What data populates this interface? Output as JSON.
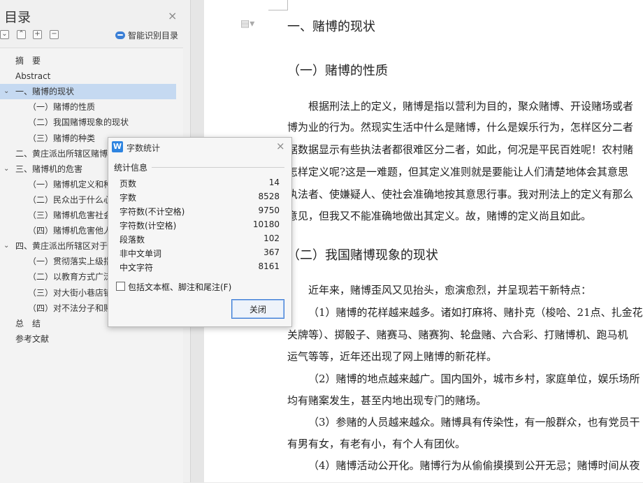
{
  "nav": {
    "title": "目录",
    "close_glyph": "×",
    "smart_label": "智能识别目录",
    "toc": [
      {
        "label": "摘　要"
      },
      {
        "label": "Abstract"
      },
      {
        "label": "一、赌博的现状",
        "expanded": true,
        "selected": true
      },
      {
        "label": "（一）赌博的性质"
      },
      {
        "label": "（二）我国赌博现象的现状"
      },
      {
        "label": "（三）赌博的种类"
      },
      {
        "label": "二、黄庄派出所辖区赌博"
      },
      {
        "label": "三、赌博机的危害",
        "expanded": true
      },
      {
        "label": "（一）赌博机定义和种"
      },
      {
        "label": "（二）民众出于什么心"
      },
      {
        "label": "（三）赌博机危害社会"
      },
      {
        "label": "（四）赌博机危害他人"
      },
      {
        "label": "四、黄庄派出所辖区对于",
        "expanded": true
      },
      {
        "label": "（一）贯彻落实上级指"
      },
      {
        "label": "（二）以教育方式广泛"
      },
      {
        "label": "（三）对大街小巷店铺"
      },
      {
        "label": "（四）对不法分子和赌"
      },
      {
        "label": "总　结"
      },
      {
        "label": "参考文献"
      }
    ]
  },
  "dialog": {
    "title": "字数统计",
    "icon_letter": "W",
    "section": "统计信息",
    "stats": [
      {
        "label": "页数",
        "value": "14"
      },
      {
        "label": "字数",
        "value": "8528"
      },
      {
        "label": "字符数(不计空格)",
        "value": "9750"
      },
      {
        "label": "字符数(计空格)",
        "value": "10180"
      },
      {
        "label": "段落数",
        "value": "102"
      },
      {
        "label": "非中文单词",
        "value": "367"
      },
      {
        "label": "中文字符",
        "value": "8161"
      }
    ],
    "checkbox_label": "包括文本框、脚注和尾注(F)",
    "close_button": "关闭"
  },
  "document": {
    "lines": [
      {
        "text": "一、赌博的现状",
        "kind": "h1"
      },
      {
        "text": "（一）赌博的性质",
        "kind": "h2"
      },
      {
        "text": "根据刑法上的定义，赌博是指以营利为目的，聚众赌博、开设赌场或者",
        "kind": "p",
        "indent": true
      },
      {
        "text": "博为业的行为。然现实生活中什么是赌博，什么是娱乐行为，怎样区分二者",
        "kind": "p"
      },
      {
        "text": "据数据显示有些执法者都很难区分二者，如此，何况是平民百姓呢！农村赌",
        "kind": "p"
      },
      {
        "text": "怎样定义呢?这是一难题，但其定义准则就是要能让人们清楚地体会其意思",
        "kind": "p"
      },
      {
        "text": "执法者、使嫌疑人、使社会准确地按其意思行事。我对刑法上的定义有那么",
        "kind": "p"
      },
      {
        "text": "意见，但我又不能准确地做出其定义。故，赌博的定义尚且如此。",
        "kind": "p"
      },
      {
        "text": "（二）我国赌博现象的现状",
        "kind": "h2"
      },
      {
        "text": "近年来，赌博歪风又见抬头，愈演愈烈，并呈现若干新特点：",
        "kind": "p",
        "indent": true
      },
      {
        "text": "（1）赌博的花样越来越多。诸如打麻将、赌扑克（梭哈、21点、扎金花",
        "kind": "p",
        "indent": true
      },
      {
        "text": "关牌等）、掷骰子、赌赛马、赌赛狗、轮盘赌、六合彩、打赌博机、跑马机",
        "kind": "p"
      },
      {
        "text": "运气等等，近年还出现了网上赌博的新花样。",
        "kind": "p"
      },
      {
        "text": "（2）赌博的地点越来越广。国内国外，城市乡村，家庭单位，娱乐场所",
        "kind": "p",
        "indent": true
      },
      {
        "text": "均有赌案发生，甚至内地出现专门的赌场。",
        "kind": "p"
      },
      {
        "text": "（3）参赌的人员越来越众。赌博具有传染性，有一般群众，也有党员干",
        "kind": "p",
        "indent": true
      },
      {
        "text": "有男有女，有老有小，有个人有团伙。",
        "kind": "p"
      },
      {
        "text": "（4）赌博活动公开化。赌博行为从偷偷摸摸到公开无忌；赌博时间从夜",
        "kind": "p",
        "indent": true
      }
    ]
  },
  "colors": {
    "selection": "#c5d9f1",
    "accent": "#2e84e0"
  },
  "icons": [
    "close-icon",
    "collapse-all-icon",
    "expand-icon",
    "add-icon",
    "remove-icon",
    "smart-recognize-icon",
    "document-icon",
    "caret-icon",
    "word-count-app-icon",
    "checkbox-icon"
  ]
}
